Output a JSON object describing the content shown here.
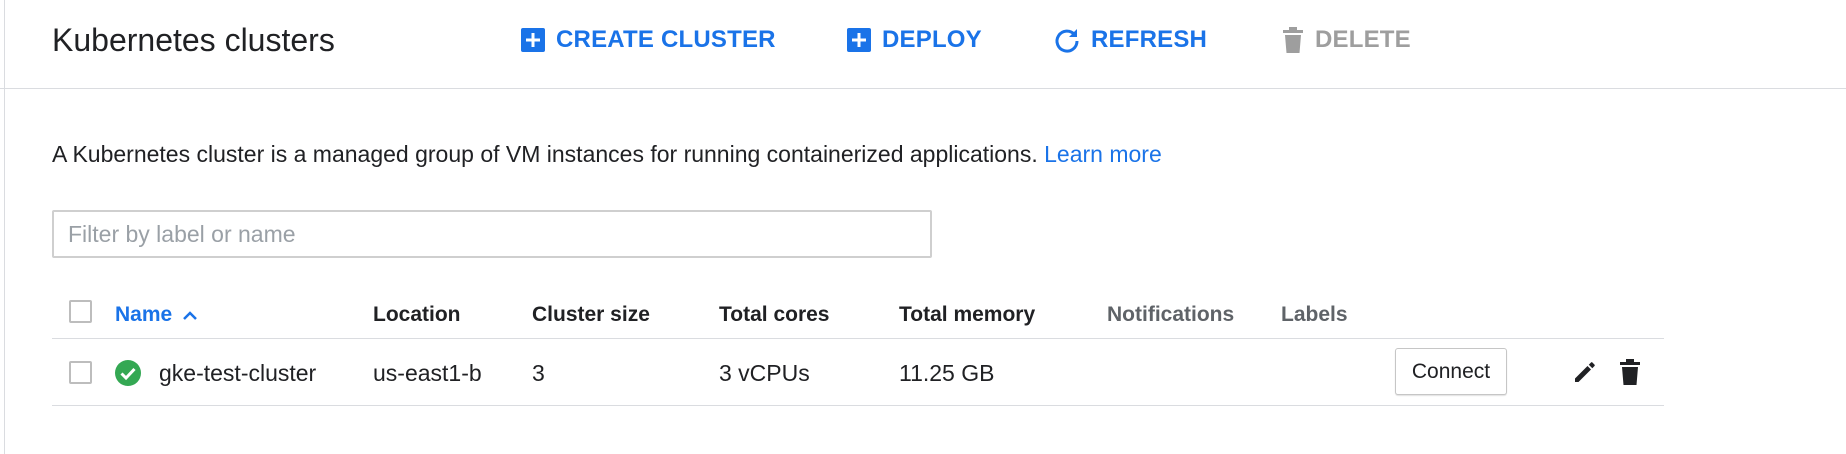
{
  "header": {
    "title": "Kubernetes clusters",
    "actions": {
      "create_cluster": "CREATE CLUSTER",
      "deploy": "DEPLOY",
      "refresh": "REFRESH",
      "delete": "DELETE"
    }
  },
  "description": {
    "text": "A Kubernetes cluster is a managed group of VM instances for running containerized applications.",
    "link": "Learn more"
  },
  "filter": {
    "placeholder": "Filter by label or name",
    "value": ""
  },
  "table": {
    "columns": {
      "name": "Name",
      "location": "Location",
      "cluster_size": "Cluster size",
      "total_cores": "Total cores",
      "total_memory": "Total memory",
      "notifications": "Notifications",
      "labels": "Labels"
    },
    "sort": {
      "column": "Name",
      "direction": "ascending"
    },
    "rows": [
      {
        "status": "running",
        "name": "gke-test-cluster",
        "location": "us-east1-b",
        "cluster_size": "3",
        "total_cores": "3 vCPUs",
        "total_memory": "11.25 GB",
        "notifications": "",
        "labels": "",
        "connect_label": "Connect"
      }
    ]
  },
  "colors": {
    "accent": "#1a73e8",
    "disabled": "#9e9e9e",
    "success": "#34a853",
    "divider": "#dadce0"
  },
  "icons": {
    "create_cluster": "add-box-icon",
    "deploy": "add-box-icon",
    "refresh": "refresh-icon",
    "delete": "trash-icon",
    "sort": "chevron-up-icon",
    "status": "check-circle-icon",
    "edit": "pencil-icon",
    "row_delete": "trash-icon"
  }
}
